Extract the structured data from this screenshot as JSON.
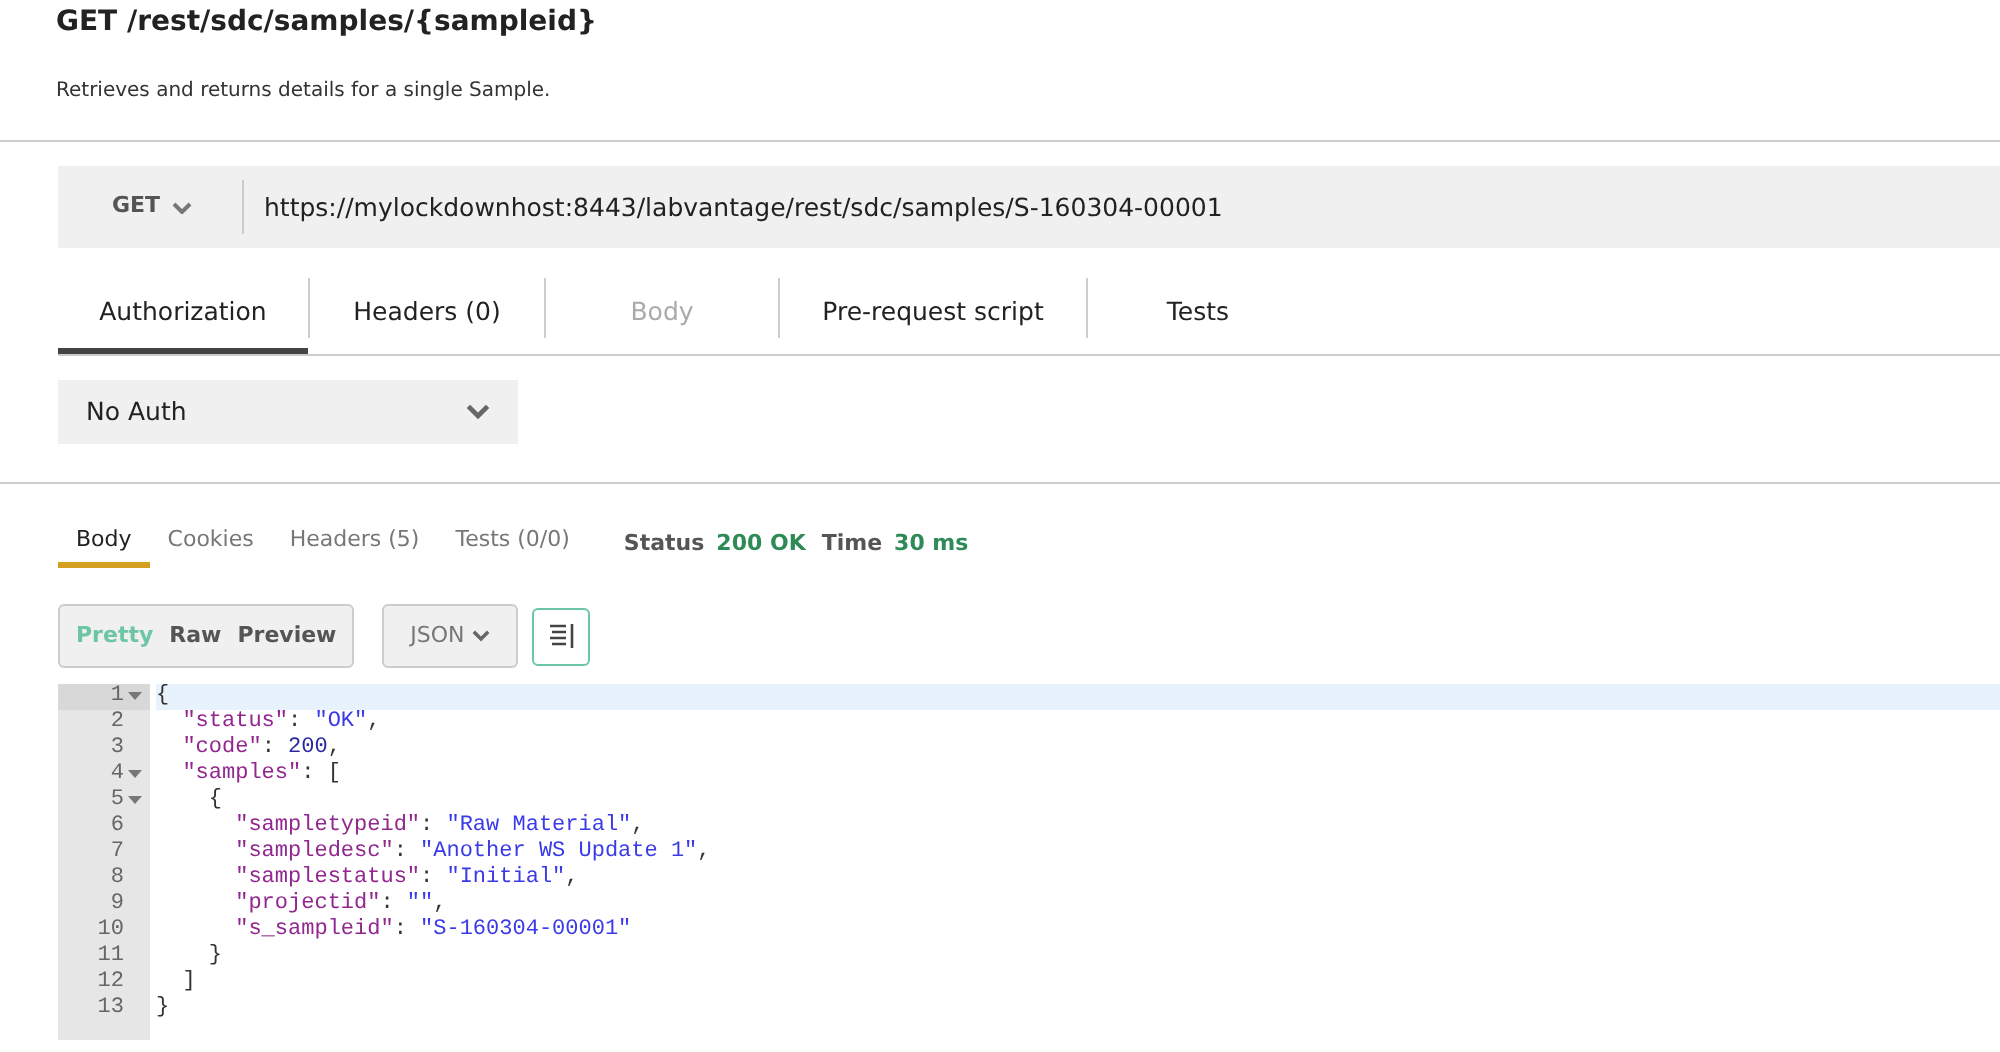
{
  "header": {
    "title": "GET /rest/sdc/samples/{sampleid}",
    "description": "Retrieves and returns details for a single Sample."
  },
  "request": {
    "method": "GET",
    "url": "https://mylockdownhost:8443/labvantage/rest/sdc/samples/S-160304-00001"
  },
  "request_tabs": [
    {
      "label": "Authorization",
      "selected": true,
      "disabled": false
    },
    {
      "label": "Headers (0)",
      "selected": false,
      "disabled": false
    },
    {
      "label": "Body",
      "selected": false,
      "disabled": true
    },
    {
      "label": "Pre-request script",
      "selected": false,
      "disabled": false
    },
    {
      "label": "Tests",
      "selected": false,
      "disabled": false
    }
  ],
  "auth": {
    "value": "No Auth"
  },
  "response_tabs": [
    {
      "label": "Body",
      "selected": true
    },
    {
      "label": "Cookies",
      "selected": false
    },
    {
      "label": "Headers (5)",
      "selected": false
    },
    {
      "label": "Tests (0/0)",
      "selected": false
    }
  ],
  "response_meta": [
    {
      "label": "Status",
      "value": "200 OK"
    },
    {
      "label": "Time",
      "value": "30 ms"
    }
  ],
  "view_modes": [
    {
      "label": "Pretty",
      "selected": true
    },
    {
      "label": "Raw",
      "selected": false
    },
    {
      "label": "Preview",
      "selected": false
    }
  ],
  "format": {
    "value": "JSON"
  },
  "code_lines": [
    {
      "number": "1",
      "foldable": true,
      "current": true,
      "tokens": [
        {
          "kind": "punct",
          "text": "{"
        }
      ]
    },
    {
      "number": "2",
      "foldable": false,
      "current": false,
      "tokens": [
        {
          "kind": "key",
          "text": "  \"status\""
        },
        {
          "kind": "punct",
          "text": ": "
        },
        {
          "kind": "str",
          "text": "\"OK\""
        },
        {
          "kind": "punct",
          "text": ","
        }
      ]
    },
    {
      "number": "3",
      "foldable": false,
      "current": false,
      "tokens": [
        {
          "kind": "key",
          "text": "  \"code\""
        },
        {
          "kind": "punct",
          "text": ": "
        },
        {
          "kind": "num",
          "text": "200"
        },
        {
          "kind": "punct",
          "text": ","
        }
      ]
    },
    {
      "number": "4",
      "foldable": true,
      "current": false,
      "tokens": [
        {
          "kind": "key",
          "text": "  \"samples\""
        },
        {
          "kind": "punct",
          "text": ": ["
        }
      ]
    },
    {
      "number": "5",
      "foldable": true,
      "current": false,
      "tokens": [
        {
          "kind": "punct",
          "text": "    {"
        }
      ]
    },
    {
      "number": "6",
      "foldable": false,
      "current": false,
      "tokens": [
        {
          "kind": "key",
          "text": "      \"sampletypeid\""
        },
        {
          "kind": "punct",
          "text": ": "
        },
        {
          "kind": "str",
          "text": "\"Raw Material\""
        },
        {
          "kind": "punct",
          "text": ","
        }
      ]
    },
    {
      "number": "7",
      "foldable": false,
      "current": false,
      "tokens": [
        {
          "kind": "key",
          "text": "      \"sampledesc\""
        },
        {
          "kind": "punct",
          "text": ": "
        },
        {
          "kind": "str",
          "text": "\"Another WS Update 1\""
        },
        {
          "kind": "punct",
          "text": ","
        }
      ]
    },
    {
      "number": "8",
      "foldable": false,
      "current": false,
      "tokens": [
        {
          "kind": "key",
          "text": "      \"samplestatus\""
        },
        {
          "kind": "punct",
          "text": ": "
        },
        {
          "kind": "str",
          "text": "\"Initial\""
        },
        {
          "kind": "punct",
          "text": ","
        }
      ]
    },
    {
      "number": "9",
      "foldable": false,
      "current": false,
      "tokens": [
        {
          "kind": "key",
          "text": "      \"projectid\""
        },
        {
          "kind": "punct",
          "text": ": "
        },
        {
          "kind": "str",
          "text": "\"\""
        },
        {
          "kind": "punct",
          "text": ","
        }
      ]
    },
    {
      "number": "10",
      "foldable": false,
      "current": false,
      "tokens": [
        {
          "kind": "key",
          "text": "      \"s_sampleid\""
        },
        {
          "kind": "punct",
          "text": ": "
        },
        {
          "kind": "str",
          "text": "\"S-160304-00001\""
        }
      ]
    },
    {
      "number": "11",
      "foldable": false,
      "current": false,
      "tokens": [
        {
          "kind": "punct",
          "text": "    }"
        }
      ]
    },
    {
      "number": "12",
      "foldable": false,
      "current": false,
      "tokens": [
        {
          "kind": "punct",
          "text": "  ]"
        }
      ]
    },
    {
      "number": "13",
      "foldable": false,
      "current": false,
      "tokens": [
        {
          "kind": "punct",
          "text": "}"
        }
      ]
    }
  ]
}
